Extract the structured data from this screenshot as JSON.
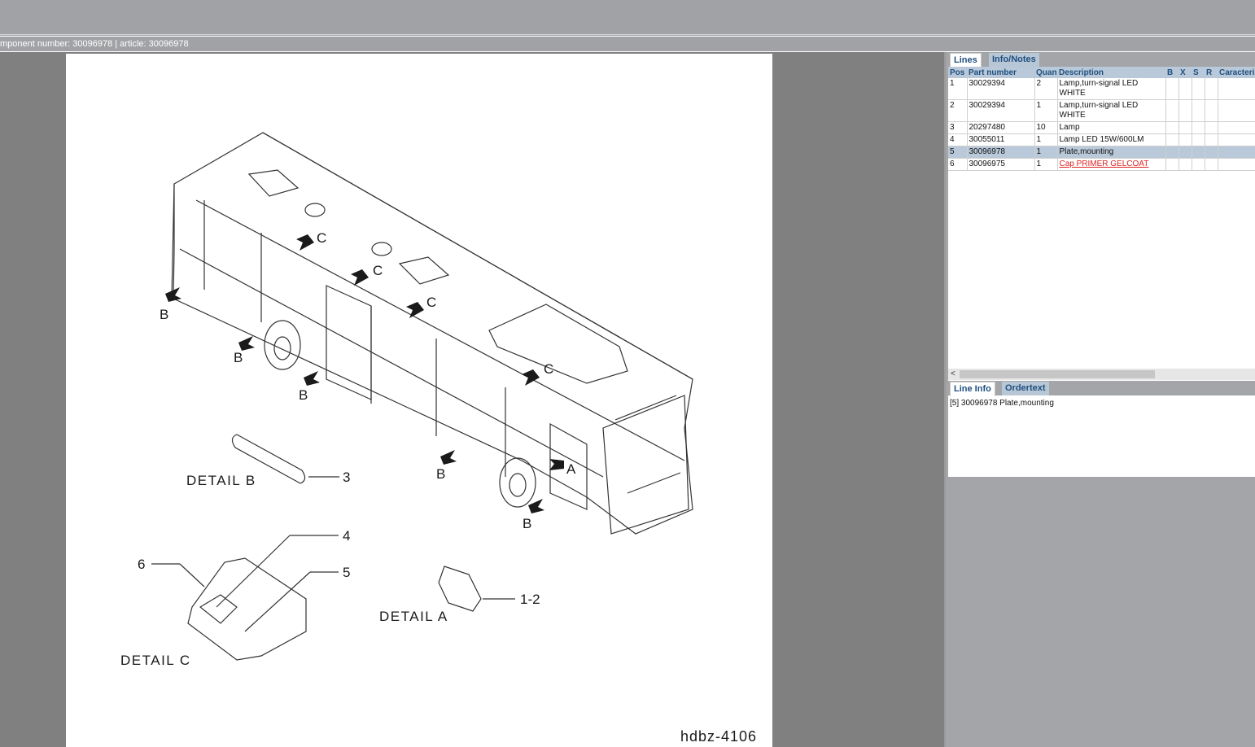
{
  "breadcrumb": "mponent number: 30096978 | article: 30096978",
  "drawing": {
    "code": "hdbz-4106",
    "callouts": {
      "a": "A",
      "b": "B",
      "c": "C"
    },
    "detail_b": "DETAIL B",
    "detail_a": "DETAIL A",
    "detail_c": "DETAIL C",
    "refs": {
      "r3": "3",
      "r4": "4",
      "r5": "5",
      "r6": "6",
      "r12": "1-2"
    }
  },
  "lines_panel": {
    "tabs": [
      "Lines",
      "Info/Notes"
    ],
    "columns": [
      "Pos",
      "Part number",
      "Quan",
      "Description",
      "B",
      "X",
      "S",
      "R",
      "Caracteri"
    ],
    "rows": [
      {
        "pos": "1",
        "part": "30029394",
        "qty": "2",
        "desc": "Lamp,turn-signal LED WHITE"
      },
      {
        "pos": "2",
        "part": "30029394",
        "qty": "1",
        "desc": "Lamp,turn-signal LED WHITE"
      },
      {
        "pos": "3",
        "part": "20297480",
        "qty": "10",
        "desc": "Lamp"
      },
      {
        "pos": "4",
        "part": "30055011",
        "qty": "1",
        "desc": "Lamp LED 15W/600LM"
      },
      {
        "pos": "5",
        "part": "30096978",
        "qty": "1",
        "desc": "Plate,mounting"
      },
      {
        "pos": "6",
        "part": "30096975",
        "qty": "1",
        "desc": "Cap PRIMER GELCOAT"
      }
    ],
    "scroll_left": "<"
  },
  "info_panel": {
    "tabs": [
      "Line Info",
      "Ordertext"
    ],
    "text": "[5] 30096978 Plate,mounting"
  }
}
